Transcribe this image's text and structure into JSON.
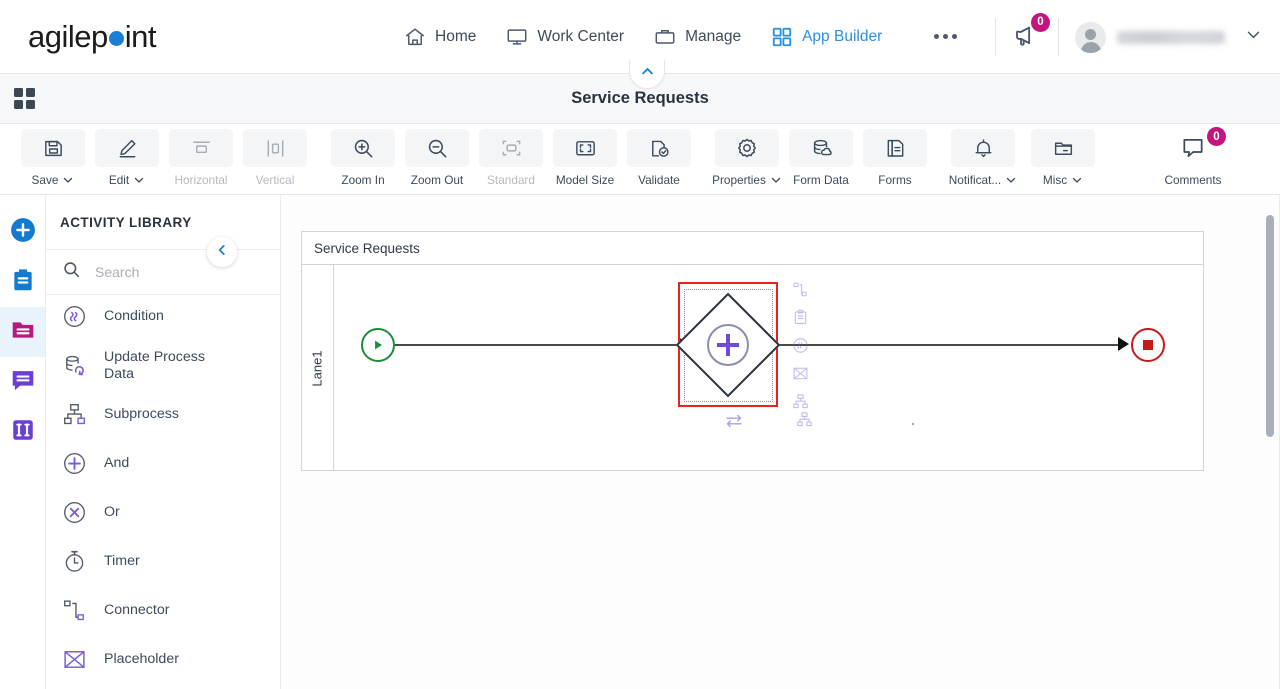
{
  "brand": {
    "name_part1": "agilep",
    "name_part2": "int",
    "accent": "#1a7fd4"
  },
  "header": {
    "nav": [
      {
        "label": "Home",
        "icon": "home-icon",
        "active": false
      },
      {
        "label": "Work Center",
        "icon": "monitor-icon",
        "active": false
      },
      {
        "label": "Manage",
        "icon": "briefcase-icon",
        "active": false
      },
      {
        "label": "App Builder",
        "icon": "grid-icon",
        "active": true
      }
    ],
    "more_label": "More",
    "announcements": {
      "icon": "megaphone-icon",
      "badge": "0",
      "badge_color": "#c2157e"
    },
    "user": {
      "name": "",
      "avatar": "user-avatar",
      "chevron": "chevron-down-icon"
    }
  },
  "titlebar": {
    "apps_icon": "grid-icon",
    "title": "Service Requests",
    "collapse_icon": "chevron-up-icon"
  },
  "toolbar": {
    "items": [
      {
        "label": "Save",
        "icon": "save-icon",
        "chevron": true,
        "disabled": false
      },
      {
        "label": "Edit",
        "icon": "pencil-icon",
        "chevron": true,
        "disabled": false
      },
      {
        "label": "Horizontal",
        "icon": "horizontal-align-icon",
        "chevron": false,
        "disabled": true
      },
      {
        "label": "Vertical",
        "icon": "vertical-align-icon",
        "chevron": false,
        "disabled": true
      },
      {
        "label": "Zoom In",
        "icon": "zoom-in-icon",
        "chevron": false,
        "disabled": false
      },
      {
        "label": "Zoom Out",
        "icon": "zoom-out-icon",
        "chevron": false,
        "disabled": false
      },
      {
        "label": "Standard",
        "icon": "standard-size-icon",
        "chevron": false,
        "disabled": true
      },
      {
        "label": "Model Size",
        "icon": "model-size-icon",
        "chevron": false,
        "disabled": false
      },
      {
        "label": "Validate",
        "icon": "validate-icon",
        "chevron": false,
        "disabled": false
      },
      {
        "label": "Properties",
        "icon": "gear-icon",
        "chevron": true,
        "disabled": false
      },
      {
        "label": "Form Data",
        "icon": "database-icon",
        "chevron": false,
        "disabled": false
      },
      {
        "label": "Forms",
        "icon": "forms-icon",
        "chevron": false,
        "disabled": false
      },
      {
        "label": "Notificat...",
        "icon": "bell-icon",
        "chevron": true,
        "disabled": false
      },
      {
        "label": "Misc",
        "icon": "folder-icon",
        "chevron": true,
        "disabled": false
      },
      {
        "label": "Comments",
        "icon": "comment-icon",
        "chevron": false,
        "disabled": false,
        "badge": "0"
      }
    ]
  },
  "rail": {
    "items": [
      {
        "name": "add-icon",
        "color": "#1479d0",
        "selected": false
      },
      {
        "name": "clipboard-icon",
        "color": "#1479d0",
        "selected": false
      },
      {
        "name": "folder-icon",
        "color": "#b8197e",
        "selected": true
      },
      {
        "name": "chat-icon",
        "color": "#6b3fd4",
        "selected": false
      },
      {
        "name": "columns-icon",
        "color": "#6b3fd4",
        "selected": false
      }
    ]
  },
  "panel": {
    "heading": "ACTIVITY LIBRARY",
    "search_placeholder": "Search",
    "search_value": "",
    "collapse_icon": "chevron-left-icon",
    "activities": [
      {
        "label": "Condition",
        "icon": "condition-icon"
      },
      {
        "label": "Update Process Data",
        "icon": "update-process-data-icon"
      },
      {
        "label": "Subprocess",
        "icon": "subprocess-icon"
      },
      {
        "label": "And",
        "icon": "and-gateway-icon"
      },
      {
        "label": "Or",
        "icon": "or-gateway-icon"
      },
      {
        "label": "Timer",
        "icon": "timer-icon"
      },
      {
        "label": "Connector",
        "icon": "connector-icon"
      },
      {
        "label": "Placeholder",
        "icon": "placeholder-icon"
      }
    ]
  },
  "canvas": {
    "pool_title": "Service Requests",
    "lane_label": "Lane1",
    "nodes": [
      {
        "type": "start-event",
        "label": "",
        "color": "#1f8a3b"
      },
      {
        "type": "gateway-selected",
        "label": "",
        "selection_color": "#e8241d",
        "plus_color": "#6f4bd8"
      },
      {
        "type": "end-event",
        "label": "",
        "color": "#c41b1b"
      }
    ],
    "quick_actions": [
      {
        "name": "connector-quick-icon"
      },
      {
        "name": "task-quick-icon"
      },
      {
        "name": "condition-quick-icon"
      },
      {
        "name": "placeholder-quick-icon"
      },
      {
        "name": "subprocess-quick-icon"
      }
    ],
    "quick_bottom_left": {
      "name": "swap-quick-icon"
    },
    "quick_bottom_right": {
      "name": "subprocess-bottom-quick-icon"
    }
  }
}
